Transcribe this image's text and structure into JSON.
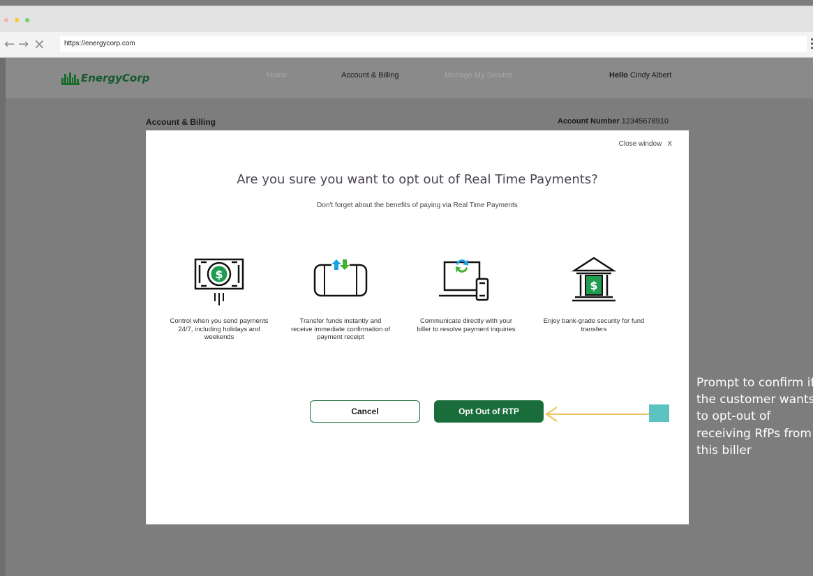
{
  "browser": {
    "url": "https://energycorp.com",
    "colors": {
      "dot_red": "#f8b2a8",
      "dot_yellow": "#f2cc2b",
      "dot_green": "#6ed16d"
    }
  },
  "site": {
    "brand": "EnergyCorp",
    "nav": {
      "home": "Home",
      "account_billing": "Account & Billing",
      "manage_service": "Manage My Service"
    },
    "greeting_prefix": "Hello",
    "user_name": "Cindy Albert"
  },
  "page": {
    "section_title": "Account & Billing",
    "account_label": "Account Number",
    "account_number": "12345678910"
  },
  "modal": {
    "close_label": "Close window",
    "close_x": "X",
    "headline": "Are you sure you want to opt out of Real Time Payments?",
    "subline": "Don't forget about the benefits of paying via Real Time Payments",
    "benefits": [
      {
        "icon": "money-bill-icon",
        "text": "Control when you send payments 24/7, including holidays and weekends"
      },
      {
        "icon": "transfer-card-icon",
        "text": "Transfer funds instantly and receive immediate confirmation of payment receipt"
      },
      {
        "icon": "devices-icon",
        "text": "Communicate directly with your biller to resolve payment inquiries"
      },
      {
        "icon": "bank-icon",
        "text": "Enjoy bank-grade security for fund transfers"
      }
    ],
    "cancel_label": "Cancel",
    "opt_out_label": "Opt Out of RTP"
  },
  "annotation": {
    "text": "Prompt to confirm if the customer wants to opt-out of receiving RfPs from this biller",
    "arrow_color": "#eec25a",
    "marker_color": "#5bc4c0"
  },
  "colors": {
    "brand_green": "#1a6d3a",
    "overlay_gray": "#7d7d7d"
  }
}
